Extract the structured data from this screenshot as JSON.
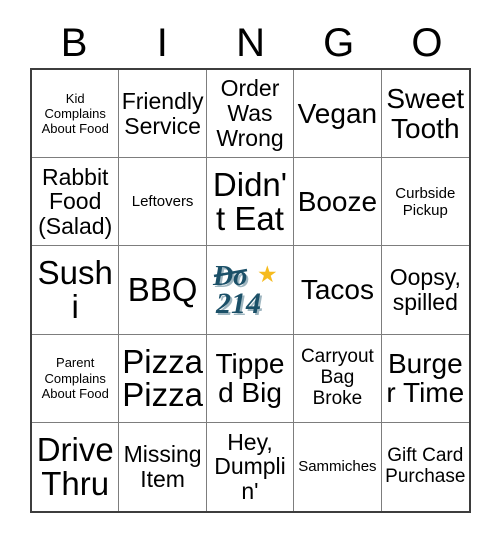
{
  "card": {
    "header_letters": [
      "B",
      "I",
      "N",
      "G",
      "O"
    ],
    "rows": [
      [
        {
          "text": "Kid Complains About Food",
          "size": "t-xs"
        },
        {
          "text": "Friendly Service",
          "size": "t-lg"
        },
        {
          "text": "Order Was Wrong",
          "size": "t-lg"
        },
        {
          "text": "Vegan",
          "size": "t-xl"
        },
        {
          "text": "Sweet Tooth",
          "size": "t-xl"
        }
      ],
      [
        {
          "text": "Rabbit Food (Salad)",
          "size": "t-lg"
        },
        {
          "text": "Leftovers",
          "size": "t-sm"
        },
        {
          "text": "Didn't Eat",
          "size": "t-xxl"
        },
        {
          "text": "Booze",
          "size": "t-xl"
        },
        {
          "text": "Curbside Pickup",
          "size": "t-sm"
        }
      ],
      [
        {
          "text": "Sushi",
          "size": "t-xxl"
        },
        {
          "text": "BBQ",
          "size": "t-xxl"
        },
        {
          "text": "",
          "size": "t-md",
          "logo": "do-214-logo"
        },
        {
          "text": "Tacos",
          "size": "t-xl"
        },
        {
          "text": "Oopsy, spilled",
          "size": "t-lg"
        }
      ],
      [
        {
          "text": "Parent Complains About Food",
          "size": "t-xs"
        },
        {
          "text": "Pizza Pizza",
          "size": "t-xxl"
        },
        {
          "text": "Tipped Big",
          "size": "t-xl"
        },
        {
          "text": "Carryout Bag Broke",
          "size": "t-md"
        },
        {
          "text": "Burger Time",
          "size": "t-xl"
        }
      ],
      [
        {
          "text": "Drive Thru",
          "size": "t-xxl"
        },
        {
          "text": "Missing Item",
          "size": "t-lg"
        },
        {
          "text": "Hey, Dumplin'",
          "size": "t-lg"
        },
        {
          "text": "Sammiches",
          "size": "t-sm"
        },
        {
          "text": "Gift Card Purchase",
          "size": "t-md"
        }
      ]
    ],
    "center_logo": {
      "name": "do-214-logo",
      "line1": "Do",
      "line2": "214",
      "star": "★",
      "text_color": "#1b5068",
      "star_color": "#f6bb1e",
      "shadow_color": "#9fb6c0"
    },
    "colors": {
      "background": "#ffffff",
      "text": "#000000",
      "grid_line": "#7d7d7d",
      "grid_border": "#3d3d3d"
    }
  }
}
